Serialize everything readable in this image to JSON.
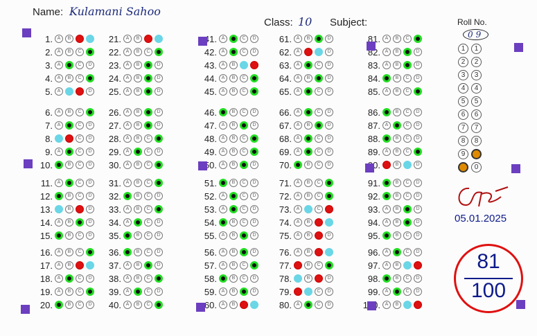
{
  "header": {
    "name_label": "Name:",
    "name_value": "Kulamani Sahoo",
    "class_label": "Class:",
    "class_value": "10",
    "subject_label": "Subject:",
    "roll_label": "Roll No.",
    "roll_value": "09"
  },
  "date": "05.01.2025",
  "score": {
    "obtained": "81",
    "total": "100"
  },
  "colors": {
    "correct": "#22dd22",
    "wrong": "#dd1111",
    "key": "#6ad6e6",
    "marker": "#6b3fbf",
    "score_ring": "#e01010",
    "ink": "#0d1a8a"
  },
  "options": [
    "A",
    "B",
    "C",
    "D"
  ],
  "roll_digits": [
    "1",
    "2",
    "3",
    "4",
    "5",
    "6",
    "7",
    "8",
    "9",
    "0"
  ],
  "answers": [
    {
      "q": "1.",
      "marks": [
        "",
        "",
        "r",
        "c"
      ]
    },
    {
      "q": "2.",
      "marks": [
        "",
        "",
        "",
        "g"
      ]
    },
    {
      "q": "3.",
      "marks": [
        "",
        "g",
        "",
        ""
      ]
    },
    {
      "q": "4.",
      "marks": [
        "",
        "",
        "",
        "g"
      ]
    },
    {
      "q": "5.",
      "marks": [
        "",
        "c",
        "r",
        ""
      ]
    },
    {
      "q": "6.",
      "marks": [
        "",
        "",
        "",
        "g"
      ]
    },
    {
      "q": "7.",
      "marks": [
        "",
        "g",
        "",
        ""
      ]
    },
    {
      "q": "8.",
      "marks": [
        "c",
        "r",
        "",
        ""
      ]
    },
    {
      "q": "9.",
      "marks": [
        "",
        "g",
        "",
        ""
      ]
    },
    {
      "q": "10.",
      "marks": [
        "g",
        "",
        "",
        ""
      ]
    },
    {
      "q": "11.",
      "marks": [
        "",
        "g",
        "",
        ""
      ]
    },
    {
      "q": "12.",
      "marks": [
        "g",
        "",
        "",
        ""
      ]
    },
    {
      "q": "13.",
      "marks": [
        "c",
        "",
        "r",
        ""
      ]
    },
    {
      "q": "14.",
      "marks": [
        "",
        "",
        "g",
        ""
      ]
    },
    {
      "q": "15.",
      "marks": [
        "g",
        "",
        "",
        ""
      ]
    },
    {
      "q": "16.",
      "marks": [
        "",
        "",
        "",
        "g"
      ]
    },
    {
      "q": "17.",
      "marks": [
        "",
        "",
        "r",
        "c"
      ]
    },
    {
      "q": "18.",
      "marks": [
        "",
        "g",
        "",
        ""
      ]
    },
    {
      "q": "19.",
      "marks": [
        "",
        "",
        "",
        "g"
      ]
    },
    {
      "q": "20.",
      "marks": [
        "g",
        "",
        "",
        ""
      ]
    },
    {
      "q": "21.",
      "marks": [
        "",
        "",
        "r",
        "c"
      ]
    },
    {
      "q": "22.",
      "marks": [
        "",
        "",
        "",
        "g"
      ]
    },
    {
      "q": "23.",
      "marks": [
        "",
        "",
        "g",
        ""
      ]
    },
    {
      "q": "24.",
      "marks": [
        "",
        "",
        "g",
        ""
      ]
    },
    {
      "q": "25.",
      "marks": [
        "",
        "",
        "g",
        ""
      ]
    },
    {
      "q": "26.",
      "marks": [
        "",
        "",
        "g",
        ""
      ]
    },
    {
      "q": "27.",
      "marks": [
        "",
        "",
        "g",
        ""
      ]
    },
    {
      "q": "28.",
      "marks": [
        "",
        "",
        "",
        "g"
      ]
    },
    {
      "q": "29.",
      "marks": [
        "",
        "g",
        "",
        ""
      ]
    },
    {
      "q": "30.",
      "marks": [
        "",
        "",
        "",
        "g"
      ]
    },
    {
      "q": "31.",
      "marks": [
        "",
        "",
        "",
        "g"
      ]
    },
    {
      "q": "32.",
      "marks": [
        "g",
        "",
        "",
        ""
      ]
    },
    {
      "q": "33.",
      "marks": [
        "",
        "",
        "",
        "g"
      ]
    },
    {
      "q": "34.",
      "marks": [
        "",
        "g",
        "",
        ""
      ]
    },
    {
      "q": "35.",
      "marks": [
        "g",
        "",
        "",
        ""
      ]
    },
    {
      "q": "36.",
      "marks": [
        "g",
        "",
        "",
        ""
      ]
    },
    {
      "q": "37.",
      "marks": [
        "",
        "",
        "g",
        ""
      ]
    },
    {
      "q": "38.",
      "marks": [
        "",
        "",
        "",
        "g"
      ]
    },
    {
      "q": "39.",
      "marks": [
        "",
        "g",
        "",
        ""
      ]
    },
    {
      "q": "40.",
      "marks": [
        "",
        "",
        "",
        "g"
      ]
    },
    {
      "q": "41.",
      "marks": [
        "",
        "g",
        "",
        ""
      ]
    },
    {
      "q": "42.",
      "marks": [
        "",
        "g",
        "",
        ""
      ]
    },
    {
      "q": "43.",
      "marks": [
        "",
        "",
        "c",
        "r"
      ]
    },
    {
      "q": "44.",
      "marks": [
        "",
        "",
        "",
        "g"
      ]
    },
    {
      "q": "45.",
      "marks": [
        "",
        "",
        "",
        "g"
      ]
    },
    {
      "q": "46.",
      "marks": [
        "g",
        "",
        "",
        ""
      ]
    },
    {
      "q": "47.",
      "marks": [
        "",
        "",
        "g",
        ""
      ]
    },
    {
      "q": "48.",
      "marks": [
        "",
        "",
        "",
        "g"
      ]
    },
    {
      "q": "49.",
      "marks": [
        "",
        "",
        "",
        "g"
      ]
    },
    {
      "q": "50.",
      "marks": [
        "",
        "",
        "g",
        ""
      ]
    },
    {
      "q": "51.",
      "marks": [
        "g",
        "",
        "",
        ""
      ]
    },
    {
      "q": "52.",
      "marks": [
        "",
        "g",
        "",
        ""
      ]
    },
    {
      "q": "53.",
      "marks": [
        "",
        "g",
        "",
        ""
      ]
    },
    {
      "q": "54.",
      "marks": [
        "g",
        "",
        "",
        ""
      ]
    },
    {
      "q": "55.",
      "marks": [
        "",
        "",
        "g",
        ""
      ]
    },
    {
      "q": "56.",
      "marks": [
        "",
        "",
        "g",
        ""
      ]
    },
    {
      "q": "57.",
      "marks": [
        "",
        "",
        "",
        "g"
      ]
    },
    {
      "q": "58.",
      "marks": [
        "g",
        "",
        "",
        ""
      ]
    },
    {
      "q": "59.",
      "marks": [
        "",
        "",
        "g",
        ""
      ]
    },
    {
      "q": "60.",
      "marks": [
        "",
        "",
        "r",
        "c"
      ]
    },
    {
      "q": "61.",
      "marks": [
        "",
        "",
        "g",
        ""
      ]
    },
    {
      "q": "62.",
      "marks": [
        "",
        "r",
        "c",
        ""
      ]
    },
    {
      "q": "63.",
      "marks": [
        "",
        "g",
        "",
        ""
      ]
    },
    {
      "q": "64.",
      "marks": [
        "",
        "",
        "g",
        ""
      ]
    },
    {
      "q": "65.",
      "marks": [
        "",
        "g",
        "",
        ""
      ]
    },
    {
      "q": "66.",
      "marks": [
        "",
        "g",
        "",
        ""
      ]
    },
    {
      "q": "67.",
      "marks": [
        "",
        "",
        "g",
        ""
      ]
    },
    {
      "q": "68.",
      "marks": [
        "",
        "g",
        "",
        ""
      ]
    },
    {
      "q": "69.",
      "marks": [
        "",
        "g",
        "",
        ""
      ]
    },
    {
      "q": "70.",
      "marks": [
        "g",
        "",
        "",
        ""
      ]
    },
    {
      "q": "71.",
      "marks": [
        "",
        "",
        "",
        "g"
      ]
    },
    {
      "q": "72.",
      "marks": [
        "",
        "",
        "",
        "g"
      ]
    },
    {
      "q": "73.",
      "marks": [
        "",
        "c",
        "",
        "r"
      ]
    },
    {
      "q": "74.",
      "marks": [
        "",
        "",
        "r",
        "c"
      ]
    },
    {
      "q": "75.",
      "marks": [
        "",
        "",
        "r",
        ""
      ]
    },
    {
      "q": "76.",
      "marks": [
        "",
        "",
        "r",
        "c"
      ]
    },
    {
      "q": "77.",
      "marks": [
        "r",
        "",
        "",
        "g"
      ]
    },
    {
      "q": "78.",
      "marks": [
        "c",
        "",
        "r",
        ""
      ]
    },
    {
      "q": "79.",
      "marks": [
        "r",
        "c",
        "",
        ""
      ]
    },
    {
      "q": "80.",
      "marks": [
        "",
        "g",
        "",
        ""
      ]
    },
    {
      "q": "81.",
      "marks": [
        "",
        "",
        "",
        "g"
      ]
    },
    {
      "q": "82.",
      "marks": [
        "",
        "",
        "g",
        ""
      ]
    },
    {
      "q": "83.",
      "marks": [
        "",
        "",
        "g",
        ""
      ]
    },
    {
      "q": "84.",
      "marks": [
        "g",
        "",
        "",
        ""
      ]
    },
    {
      "q": "85.",
      "marks": [
        "",
        "",
        "",
        "g"
      ]
    },
    {
      "q": "86.",
      "marks": [
        "g",
        "",
        "",
        ""
      ]
    },
    {
      "q": "87.",
      "marks": [
        "",
        "g",
        "",
        ""
      ]
    },
    {
      "q": "88.",
      "marks": [
        "g",
        "",
        "",
        ""
      ]
    },
    {
      "q": "89.",
      "marks": [
        "",
        "",
        "",
        "g"
      ]
    },
    {
      "q": "90.",
      "marks": [
        "r",
        "",
        "c",
        ""
      ]
    },
    {
      "q": "91.",
      "marks": [
        "g",
        "",
        "",
        ""
      ]
    },
    {
      "q": "92.",
      "marks": [
        "g",
        "",
        "",
        ""
      ]
    },
    {
      "q": "93.",
      "marks": [
        "",
        "",
        "g",
        ""
      ]
    },
    {
      "q": "94.",
      "marks": [
        "",
        "",
        "g",
        ""
      ]
    },
    {
      "q": "95.",
      "marks": [
        "g",
        "",
        "",
        ""
      ]
    },
    {
      "q": "96.",
      "marks": [
        "",
        "g",
        "",
        ""
      ]
    },
    {
      "q": "97.",
      "marks": [
        "",
        "",
        "c",
        "r"
      ]
    },
    {
      "q": "98.",
      "marks": [
        "g",
        "",
        "",
        ""
      ]
    },
    {
      "q": "99.",
      "marks": [
        "",
        "g",
        "",
        ""
      ]
    },
    {
      "q": "100.",
      "marks": [
        "",
        "",
        "c",
        "r"
      ]
    }
  ]
}
